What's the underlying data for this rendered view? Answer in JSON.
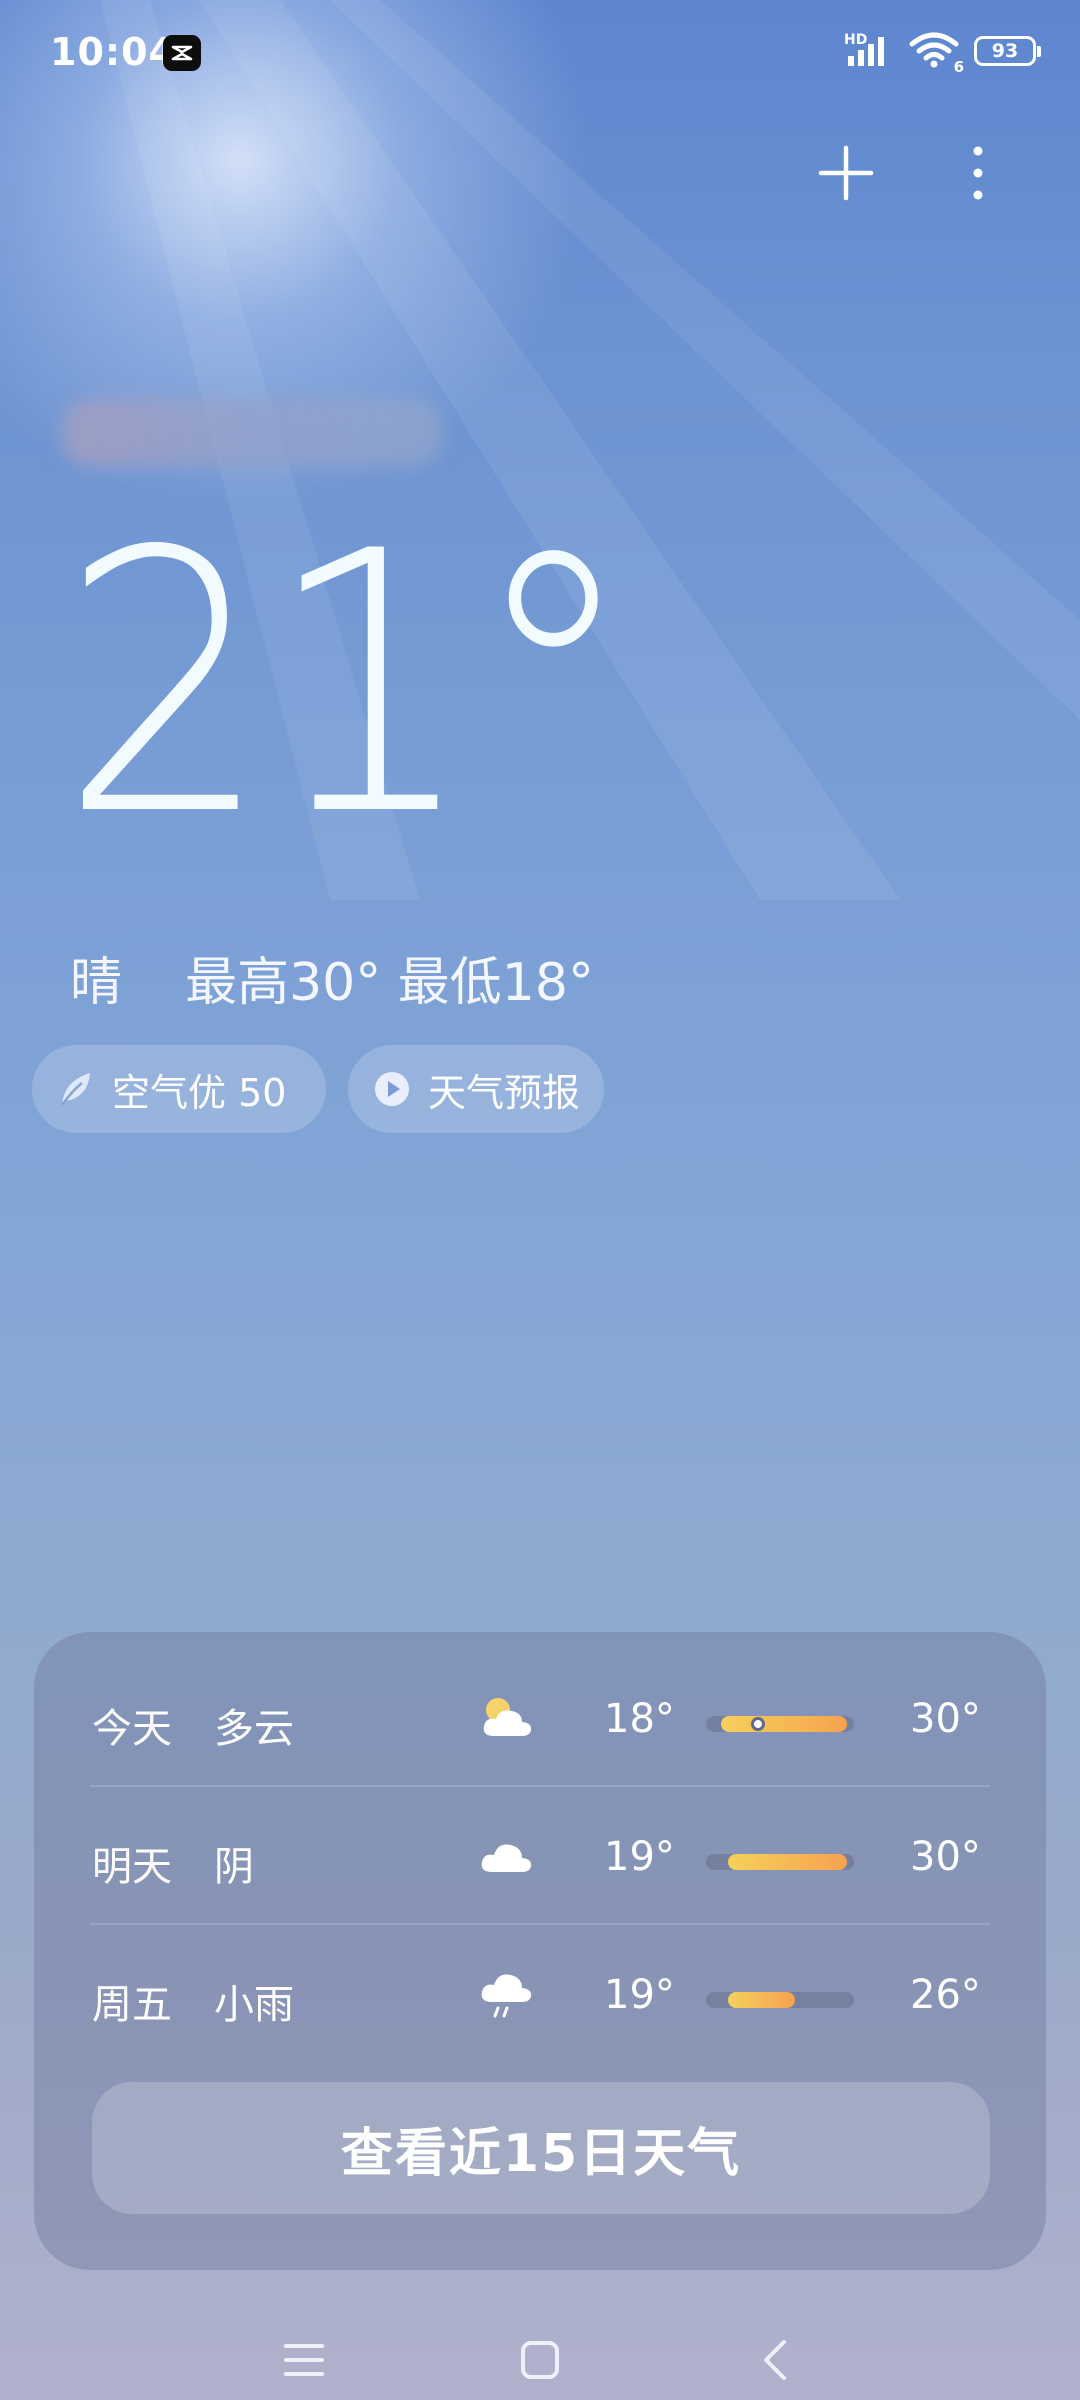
{
  "status_bar": {
    "time": "10:04",
    "battery": "93",
    "signal_label": "HD",
    "wifi_label": "6",
    "icons": [
      "capcut-icon",
      "signal-icon",
      "wifi-icon",
      "battery-icon"
    ]
  },
  "current": {
    "temperature": "21°",
    "condition": "晴",
    "high_low": "最高30° 最低18°"
  },
  "chips": {
    "aqi": "空气优 50",
    "forecast_video": "天气预报"
  },
  "forecast": [
    {
      "day": "今天",
      "desc": "多云",
      "icon": "partly-cloudy-icon",
      "low": "18°",
      "high": "30°",
      "range_start": 0.1,
      "range_end": 0.95,
      "current": 0.35
    },
    {
      "day": "明天",
      "desc": "阴",
      "icon": "cloud-icon",
      "low": "19°",
      "high": "30°",
      "range_start": 0.15,
      "range_end": 0.95
    },
    {
      "day": "周五",
      "desc": "小雨",
      "icon": "light-rain-icon",
      "low": "19°",
      "high": "26°",
      "range_start": 0.15,
      "range_end": 0.6
    }
  ],
  "cta": "查看近15日天气",
  "colors": {
    "sky_top": "#5d86cf",
    "sky_bottom": "#b0b1cc",
    "bar_start": "#f5d05c",
    "bar_end": "#f6a24f"
  }
}
